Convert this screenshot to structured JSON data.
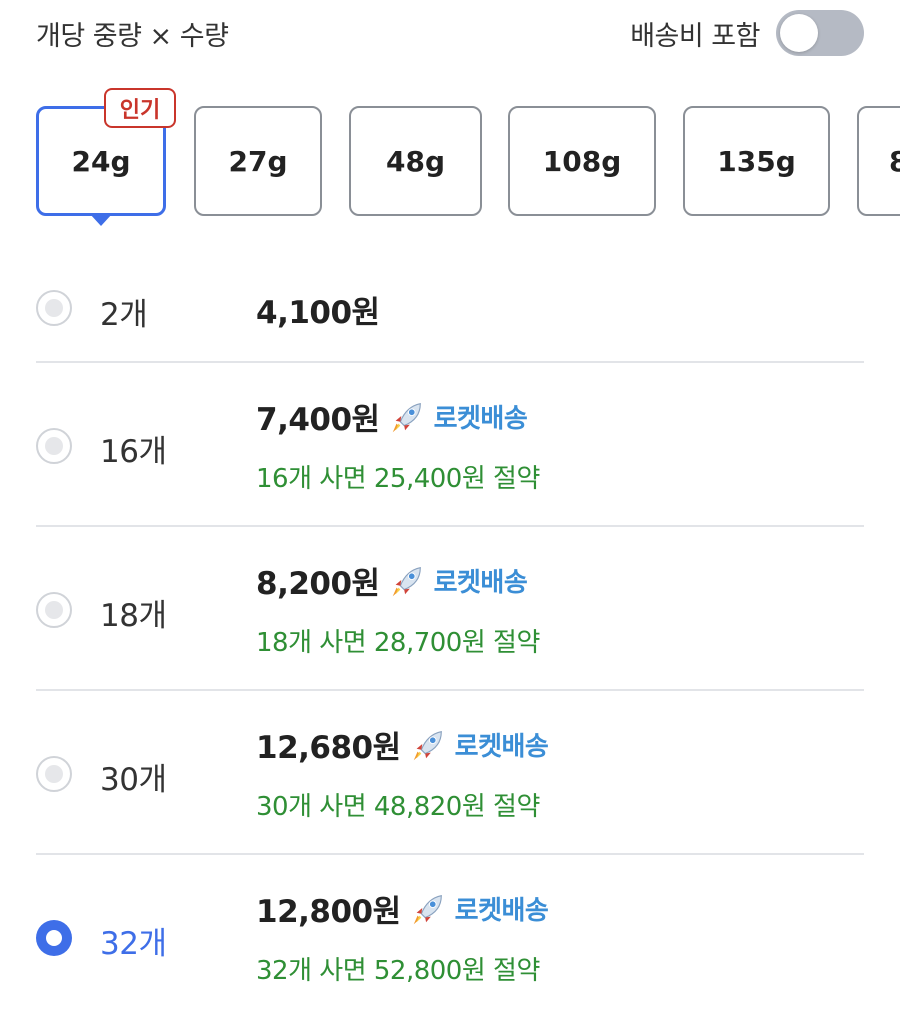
{
  "header": {
    "title": "개당 중량 × 수량",
    "shipping_toggle_label": "배송비 포함",
    "shipping_toggle_on": false
  },
  "weights": {
    "badge": "인기",
    "selected_index": 0,
    "tabs": [
      "24g",
      "27g",
      "48g",
      "108g",
      "135g",
      "8"
    ]
  },
  "options": [
    {
      "qty": "2개",
      "price": "4,100원",
      "rocket": null,
      "saving": null,
      "selected": false
    },
    {
      "qty": "16개",
      "price": "7,400원",
      "rocket": "로켓배송",
      "saving": "16개 사면 25,400원 절약",
      "selected": false
    },
    {
      "qty": "18개",
      "price": "8,200원",
      "rocket": "로켓배송",
      "saving": "18개 사면 28,700원 절약",
      "selected": false
    },
    {
      "qty": "30개",
      "price": "12,680원",
      "rocket": "로켓배송",
      "saving": "30개 사면 48,820원 절약",
      "selected": false
    },
    {
      "qty": "32개",
      "price": "12,800원",
      "rocket": "로켓배송",
      "saving": "32개 사면 52,800원 절약",
      "selected": true
    }
  ],
  "colors": {
    "accent": "#3e6ee8",
    "saving": "#2f8f35",
    "rocket": "#3b8ed6",
    "badge": "#c9352b"
  },
  "icons": {
    "rocket": "rocket-icon",
    "radio": "radio-button-icon"
  }
}
